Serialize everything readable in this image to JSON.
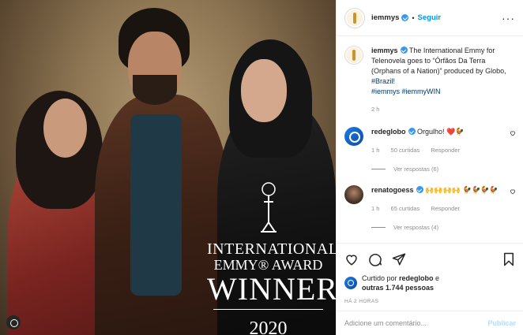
{
  "post": {
    "award": {
      "line1": "INTERNATIONAL",
      "line2": "EMMY® AWARD",
      "line3": "WINNER",
      "line4": "2020"
    }
  },
  "header": {
    "username": "iemmys",
    "follow_label": "Seguir",
    "more": "···"
  },
  "caption": {
    "username": "iemmys",
    "text": " The International Emmy for Telenovela goes to “Órfãos Da Terra (Orphans of a Nation)” produced by Globo, ",
    "tag1": "#Brazil!",
    "tag2": "#iemmys",
    "tag3": "#iemmyWIN",
    "time": "2 h"
  },
  "comments": [
    {
      "username": "redeglobo",
      "text": " Orgulho! ",
      "emoji": "❤️🐓",
      "time": "1 h",
      "likes": "50 curtidas",
      "reply": "Responder",
      "view_replies": "Ver respostas (6)"
    },
    {
      "username": "renatogoess",
      "text": " ",
      "emoji": "🙌🙌🙌🙌 🐓🐓🐓🐓",
      "time": "1 h",
      "likes": "65 curtidas",
      "reply": "Responder",
      "view_replies": "Ver respostas (4)"
    }
  ],
  "actions": {
    "liked_prefix": "Curtido por ",
    "liked_user": "redeglobo",
    "liked_and": " e",
    "liked_others": "outras 1.744 pessoas",
    "timestamp": "HÁ 2 HORAS"
  },
  "add_comment": {
    "placeholder": "Adicione um comentário...",
    "post_label": "Publicar"
  },
  "colors": {
    "link": "#00376b",
    "follow": "#0095f6",
    "verified": "#3897f0",
    "muted": "#8e8e8e"
  }
}
